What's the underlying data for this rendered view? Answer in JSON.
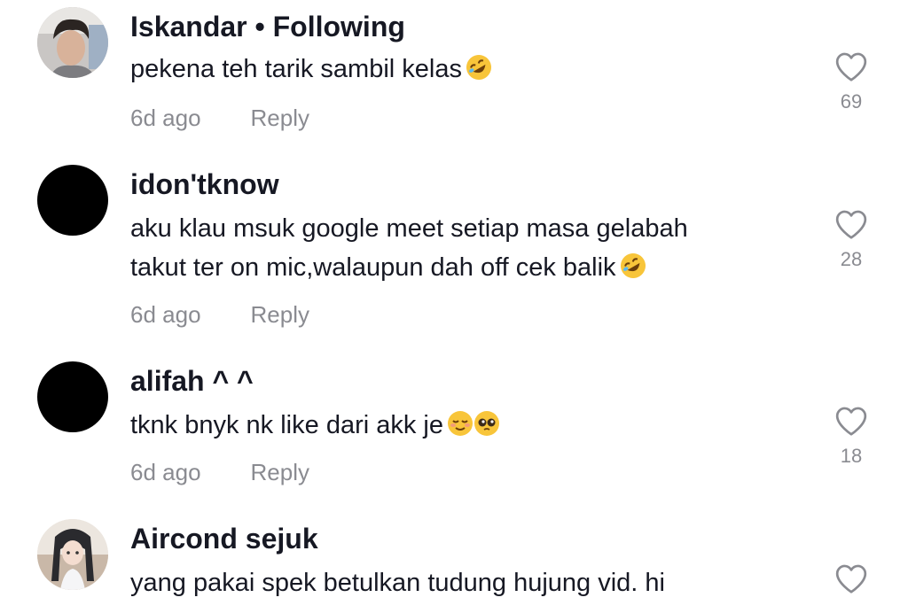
{
  "comments": [
    {
      "username": "Iskandar • Following",
      "text_lines": [
        "pekena teh tarik sambil kelas"
      ],
      "emojis": [
        "rolling-on-floor-laughing"
      ],
      "time": "6d ago",
      "reply_label": "Reply",
      "likes": "69",
      "avatar": "profile-photo"
    },
    {
      "username": "idon'tknow",
      "text_lines": [
        "aku klau msuk google meet setiap masa gelabah",
        "takut ter on mic,walaupun dah off cek balik"
      ],
      "emojis": [
        "rolling-on-floor-laughing"
      ],
      "time": "6d ago",
      "reply_label": "Reply",
      "likes": "28",
      "avatar": "black-circle"
    },
    {
      "username": "alifah ^ ^",
      "text_lines": [
        "tknk bnyk nk like dari akk je"
      ],
      "emojis": [
        "relieved-face",
        "pleading-face"
      ],
      "time": "6d ago",
      "reply_label": "Reply",
      "likes": "18",
      "avatar": "black-circle"
    },
    {
      "username": "Aircond sejuk",
      "text_lines": [
        "yang pakai spek betulkan tudung hujung vid. hi"
      ],
      "emojis": [],
      "time": "",
      "reply_label": "",
      "likes": "",
      "avatar": "anime-girl"
    }
  ],
  "colors": {
    "text": "#161823",
    "muted": "#8a8b91",
    "heart_outline": "#8a8b91"
  },
  "icons": {
    "like": "heart-outline-icon"
  }
}
